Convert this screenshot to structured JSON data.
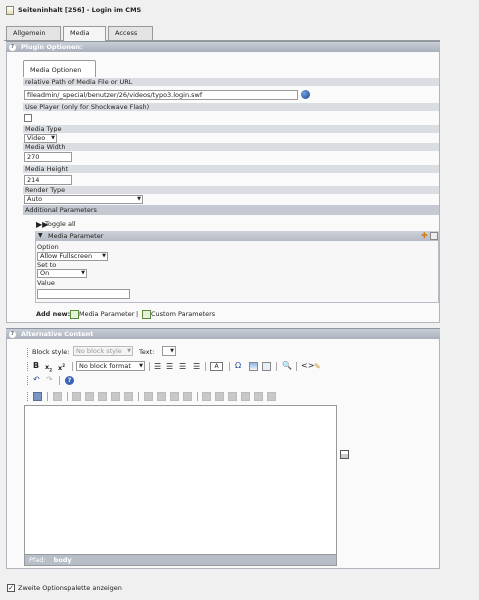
{
  "header": {
    "title": "Seiteninhalt [256] - Login im CMS",
    "icon": "page-content-icon"
  },
  "tabs": [
    {
      "label": "Allgemein"
    },
    {
      "label": "Media"
    },
    {
      "label": "Access"
    }
  ],
  "plugin": {
    "section_title": "Plugin Optionen:",
    "subtab_label": "Media Optionen",
    "path_label": "relative Path of Media File or URL",
    "path_value": "fileadmin/_special/benutzer/26/videos/typo3.login.swf",
    "use_player_label": "Use Player (only for Shockwave Flash)",
    "media_type_label": "Media Type",
    "media_type_value": "Video",
    "media_width_label": "Media Width",
    "media_width_value": "270",
    "media_height_label": "Media Height",
    "media_height_value": "214",
    "render_type_label": "Render Type",
    "render_type_value": "Auto",
    "additional_params_label": "Additional Parameters",
    "toggle_all_label": "Toggle all",
    "media_parameter_title": "Media Parameter",
    "option_label": "Option",
    "option_value": "Allow Fullscreen",
    "set_to_label": "Set to",
    "set_to_value": "On",
    "value_label": "Value",
    "value_value": "",
    "add_new_label": "Add new:",
    "add_media_parameter": "Media Parameter",
    "add_separator": "|",
    "add_custom_parameters": "Custom Parameters"
  },
  "alternative": {
    "section_title": "Alternative Content",
    "block_style_label": "Block style:",
    "block_style_value": "No block style",
    "text_label": "Text:",
    "text_value": "",
    "block_format_value": "No block format",
    "path_label": "Pfad:",
    "path_value": "body"
  },
  "footer": {
    "checkbox_checked": true,
    "checkbox_label": "Zweite Optionspalette anzeigen"
  },
  "colors": {
    "panel_head": "#b3b9c4",
    "row_grey": "#dadde2",
    "status_bar": "#b8bec8"
  }
}
